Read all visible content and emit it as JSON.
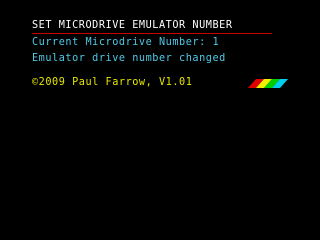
{
  "screen": {
    "title": "SET MICRODRIVE EMULATOR NUMBER",
    "current_label": "Current Microdrive Number: 1",
    "status_message": "Emulator drive number changed",
    "copyright": "©2009 Paul Farrow, V1.01"
  },
  "colors": {
    "background": "#000000",
    "title": "#ffffff",
    "title_underline": "#c80000",
    "info_text": "#4ec9e6",
    "copyright_text": "#e6e600",
    "stripe_red": "#e00000",
    "stripe_yellow": "#f0f000",
    "stripe_green": "#00d000",
    "stripe_cyan": "#00d0f0"
  },
  "icons": {
    "rainbow_stripes": "spectrum-rainbow-stripes-icon"
  }
}
